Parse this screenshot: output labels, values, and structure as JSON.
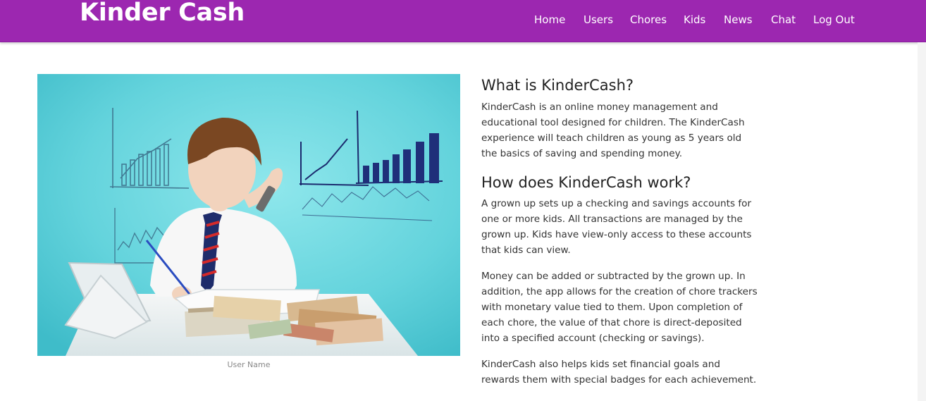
{
  "navbar": {
    "brand": "Kinder Cash",
    "links": [
      "Home",
      "Users",
      "Chores",
      "Kids",
      "News",
      "Chat",
      "Log Out"
    ]
  },
  "hero": {
    "caption": "User Name"
  },
  "about": {
    "title": "What is KinderCash?",
    "body": "KinderCash is an online money management and educational tool designed for children. The KinderCash experience will teach children as young as 5 years old the basics of saving and spending money."
  },
  "how": {
    "title": "How does KinderCash work?",
    "paragraphs": [
      "A grown up sets up a checking and savings accounts for one or more kids. All transactions are managed by the grown up. Kids have view-only access to these accounts that kids can view.",
      "Money can be added or subtracted by the grown up. In addition, the app allows for the creation of chore trackers with monetary value tied to them. Upon completion of each chore, the value of that chore is direct-deposited into a specified account (checking or savings).",
      "KinderCash also helps kids set financial goals and rewards them with special badges for each achievement."
    ]
  },
  "colors": {
    "navbar": "#9c27b0",
    "photo_background": "#6fd6de"
  }
}
